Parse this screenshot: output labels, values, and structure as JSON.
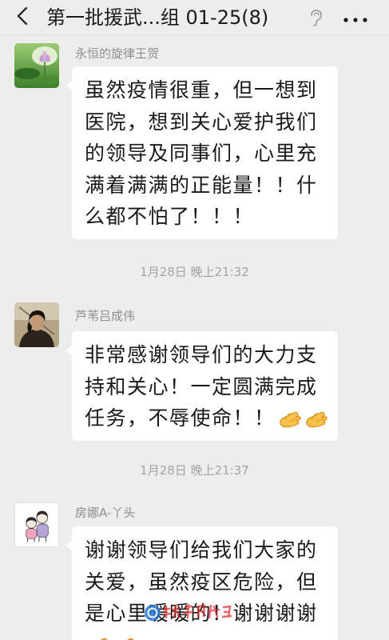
{
  "header": {
    "title": "第一批援武...组 01-25(8)",
    "back_icon": "chevron-left-icon",
    "earpiece_icon": "earpiece-mode-icon",
    "more_icon": "more-dots-icon"
  },
  "messages": [
    {
      "sender": "永恒的旋律王贺",
      "lines": [
        "虽然疫情很重，但一想到",
        "医院，想到关心爱护我们",
        "的领导及同事们，心里充",
        "满着满满的正能量！！什",
        "么都不怕了！！！"
      ]
    },
    {
      "sender": "芦苇吕成伟",
      "lines": [
        "非常感谢领导们的大力支",
        "持和关心！一定圆满完成",
        "任务，不辱使命！！"
      ],
      "emoji": [
        "hands-emoji-icon",
        "hands-emoji-icon"
      ]
    },
    {
      "sender": "房娜A-丫头",
      "lines": [
        "谢谢领导们给我们大家的",
        "关爱，虽然疫区危险，但",
        "是心里暖暖的！谢谢谢谢"
      ],
      "emoji": [
        "emoji-icon",
        "emoji-icon"
      ]
    }
  ],
  "timestamps": [
    "1月28日 晚上21:32",
    "1月28日 晚上21:37"
  ],
  "colors": {
    "background": "#EDEDED",
    "header_background": "#EDEDED",
    "bubble": "#FFFFFF",
    "text": "#191919",
    "secondary_text": "#8E8E8E",
    "timestamp_text": "#A3A3A3"
  }
}
